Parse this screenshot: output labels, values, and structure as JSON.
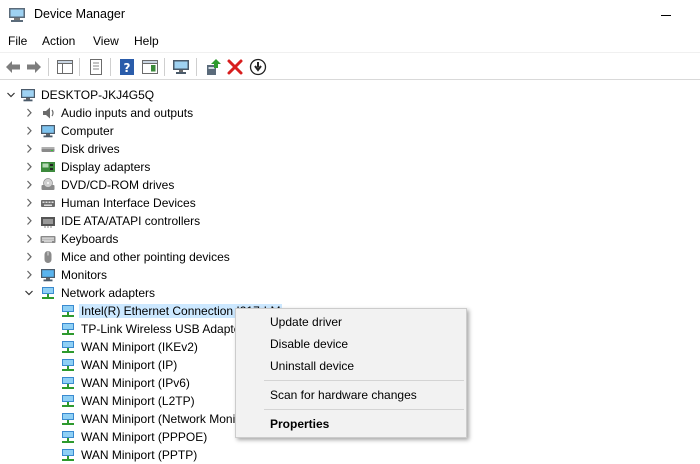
{
  "window": {
    "title": "Device Manager"
  },
  "menu": [
    "File",
    "Action",
    "View",
    "Help"
  ],
  "toolbar_icons": [
    "back-arrow-icon",
    "forward-arrow-icon",
    "show-hide-console-tree-icon",
    "properties-icon",
    "help-icon",
    "action-pane-icon",
    "scan-hardware-icon",
    "update-driver-icon",
    "uninstall-device-icon",
    "disable-device-icon"
  ],
  "tree": {
    "root": "DESKTOP-JKJ4G5Q",
    "categories": [
      "Audio inputs and outputs",
      "Computer",
      "Disk drives",
      "Display adapters",
      "DVD/CD-ROM drives",
      "Human Interface Devices",
      "IDE ATA/ATAPI controllers",
      "Keyboards",
      "Mice and other pointing devices",
      "Monitors",
      "Network adapters"
    ],
    "network_devices": [
      "Intel(R) Ethernet Connection I217-LM",
      "TP-Link Wireless USB Adapter",
      "WAN Miniport (IKEv2)",
      "WAN Miniport (IP)",
      "WAN Miniport (IPv6)",
      "WAN Miniport (L2TP)",
      "WAN Miniport (Network Monitor)",
      "WAN Miniport (PPPOE)",
      "WAN Miniport (PPTP)"
    ]
  },
  "context_menu": {
    "update": "Update driver",
    "disable": "Disable device",
    "uninstall": "Uninstall device",
    "scan": "Scan for hardware changes",
    "properties": "Properties"
  }
}
